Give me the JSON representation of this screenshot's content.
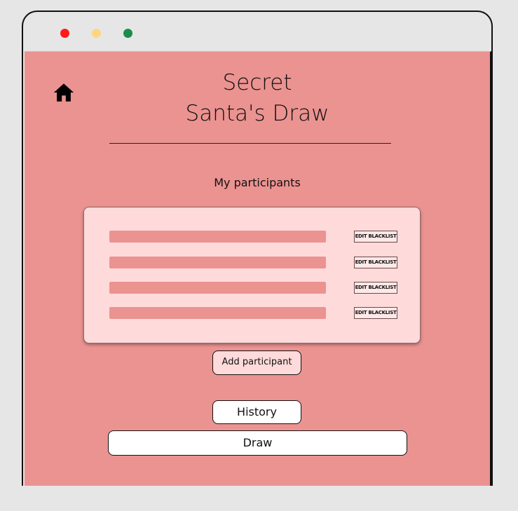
{
  "window": {
    "controls": [
      "close",
      "minimize",
      "maximize"
    ],
    "colors": {
      "close": "#ff1a1a",
      "minimize": "#ffd582",
      "maximize": "#1a8c4e"
    }
  },
  "header": {
    "home_icon": "home-icon",
    "title_line1": "Secret",
    "title_line2": "Santa's Draw"
  },
  "participants": {
    "section_title": "My participants",
    "rows": [
      {
        "edit_label": "EDIT BLACKLIST"
      },
      {
        "edit_label": "EDIT BLACKLIST"
      },
      {
        "edit_label": "EDIT BLACKLIST"
      },
      {
        "edit_label": "EDIT BLACKLIST"
      }
    ],
    "add_label": "Add participant"
  },
  "actions": {
    "history_label": "History",
    "draw_label": "Draw"
  },
  "colors": {
    "page_bg": "#eb9391",
    "card_bg": "#ffdada",
    "placeholder_bar": "#eb9391",
    "outer_bg": "#e6e6e6"
  }
}
